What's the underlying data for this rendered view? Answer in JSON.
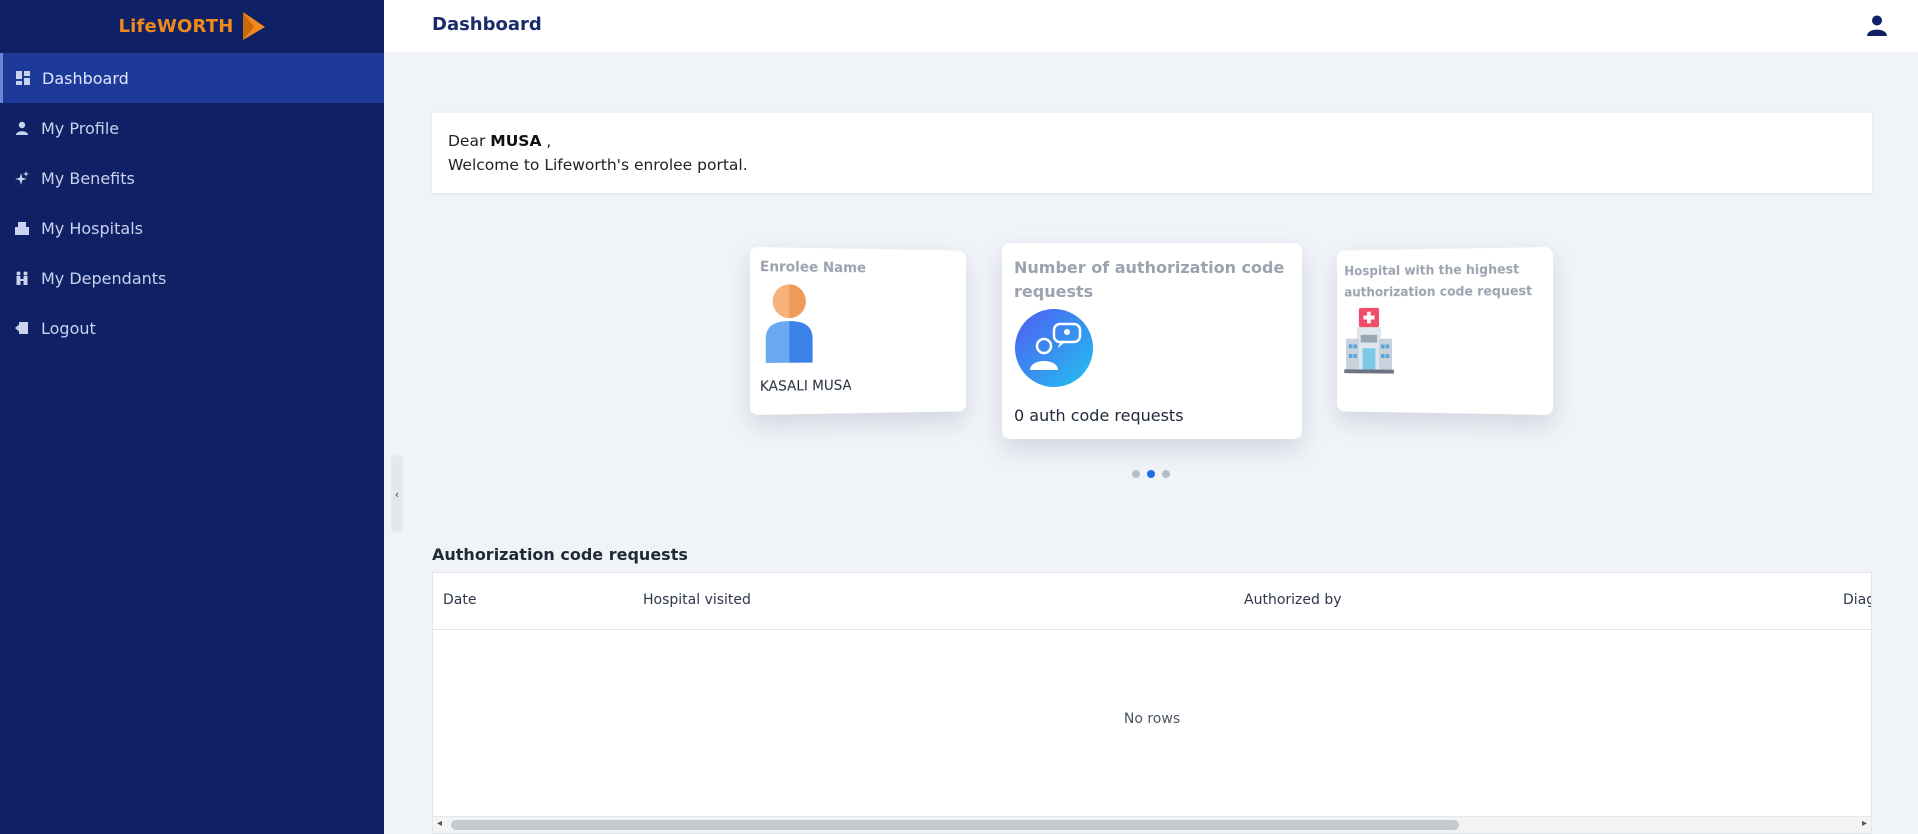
{
  "brand": {
    "name": "LifeWORTH",
    "accent": "#f08a1c",
    "sidebar_bg": "#0f2064"
  },
  "sidebar": {
    "items": [
      {
        "label": "Dashboard",
        "icon": "dashboard-icon",
        "active": true
      },
      {
        "label": "My Profile",
        "icon": "person-icon"
      },
      {
        "label": "My Benefits",
        "icon": "sparkle-icon"
      },
      {
        "label": "My Hospitals",
        "icon": "hospital-icon"
      },
      {
        "label": "My Dependants",
        "icon": "family-icon"
      },
      {
        "label": "Logout",
        "icon": "logout-icon"
      }
    ],
    "collapse_glyph": "‹"
  },
  "header": {
    "title": "Dashboard",
    "user_icon": "account-icon"
  },
  "welcome": {
    "greeting": "Dear",
    "name": "MUSA",
    "suffix": " ,",
    "message": "Welcome to Lifeworth's enrolee portal."
  },
  "cards": {
    "enrolee": {
      "title": "Enrolee Name",
      "value": "KASALI MUSA"
    },
    "auth_requests": {
      "title": "Number of authorization code requests",
      "value": "0 auth code requests"
    },
    "top_hospital": {
      "title": "Hospital with the highest authorization code request"
    }
  },
  "carousel": {
    "count": 3,
    "active_index": 1
  },
  "table": {
    "title": "Authorization code requests",
    "columns": [
      "Date",
      "Hospital visited",
      "Authorized by",
      "Diag"
    ],
    "empty_text": "No rows",
    "scroll_left": "◂",
    "scroll_right": "▸"
  }
}
